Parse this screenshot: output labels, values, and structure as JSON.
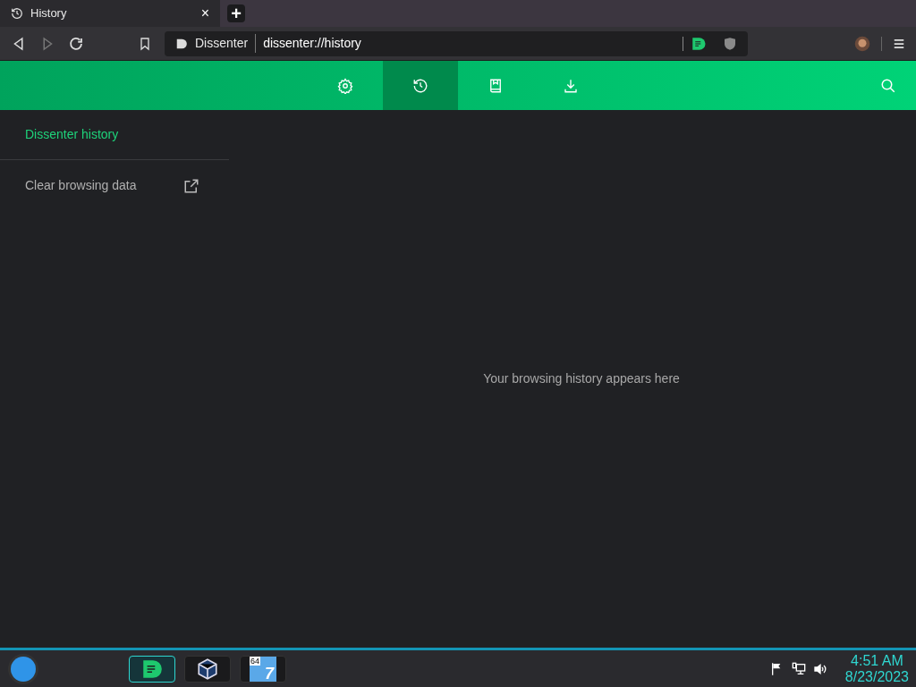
{
  "browser": {
    "tab": {
      "title": "History",
      "close": "×"
    },
    "new_tab": "+",
    "address": {
      "site": "Dissenter",
      "url": "dissenter://history"
    }
  },
  "header": {
    "tabs": [
      {
        "kind": "settings",
        "selected": false
      },
      {
        "kind": "history",
        "selected": true
      },
      {
        "kind": "bookmarks",
        "selected": false
      },
      {
        "kind": "downloads",
        "selected": false
      }
    ]
  },
  "sidebar": {
    "title": "Dissenter history",
    "items": [
      {
        "label": "Clear browsing data"
      }
    ]
  },
  "main": {
    "empty_message": "Your browsing history appears here"
  },
  "taskbar": {
    "apps": [
      {
        "kind": "dissenter",
        "selected": true
      },
      {
        "kind": "virtualbox",
        "selected": false
      },
      {
        "kind": "win7",
        "selected": false,
        "badge": "64",
        "number": "7"
      }
    ],
    "time": "4:51 AM",
    "date": "8/23/2023"
  }
}
